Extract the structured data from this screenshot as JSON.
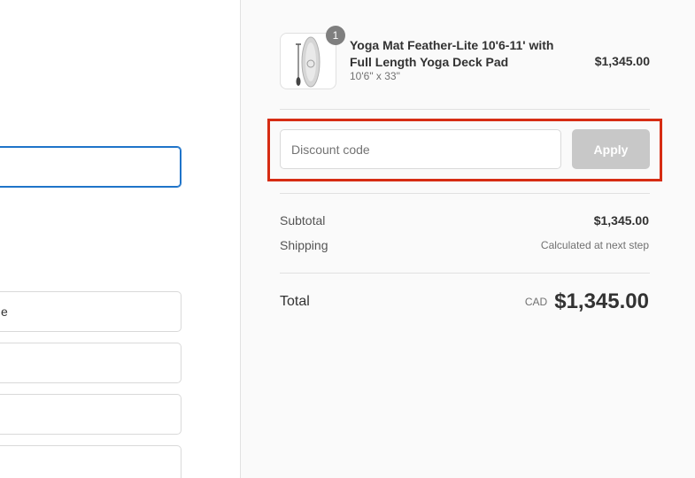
{
  "left_form": {
    "partial_field_text": "e"
  },
  "order_summary": {
    "item": {
      "quantity": "1",
      "title": "Yoga Mat Feather-Lite 10'6-11' with Full Length Yoga Deck Pad",
      "variant": "10'6\" x 33\"",
      "price": "$1,345.00",
      "image_icon": "paddle-board-icon"
    },
    "discount": {
      "placeholder": "Discount code",
      "apply_label": "Apply",
      "highlight_color": "#d62c13"
    },
    "subtotal": {
      "label": "Subtotal",
      "value": "$1,345.00"
    },
    "shipping": {
      "label": "Shipping",
      "value": "Calculated at next step"
    },
    "total": {
      "label": "Total",
      "currency": "CAD",
      "value": "$1,345.00"
    }
  },
  "colors": {
    "focus_border": "#1f74c9",
    "apply_button_disabled": "#c8c8c8",
    "summary_background": "#fafafa"
  }
}
